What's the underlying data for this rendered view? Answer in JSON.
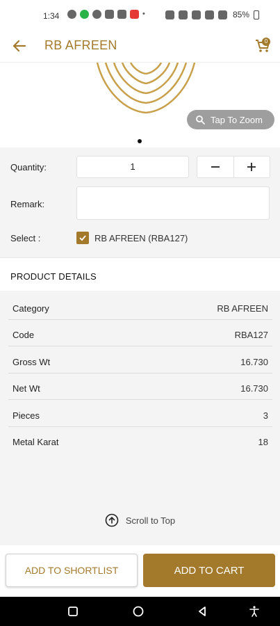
{
  "status_bar": {
    "time": "1:34",
    "battery": "85%"
  },
  "app_bar": {
    "title": "RB AFREEN",
    "cart_count": "0"
  },
  "image": {
    "zoom_label": "Tap To Zoom"
  },
  "form": {
    "quantity_label": "Quantity:",
    "quantity_value": "1",
    "remark_label": "Remark:",
    "remark_value": "",
    "select_label": "Select :",
    "select_option": "RB AFREEN (RBA127)"
  },
  "details": {
    "title": "PRODUCT DETAILS",
    "rows": [
      {
        "label": "Category",
        "value": "RB AFREEN"
      },
      {
        "label": "Code",
        "value": "RBA127"
      },
      {
        "label": "Gross Wt",
        "value": "16.730"
      },
      {
        "label": "Net Wt",
        "value": "16.730"
      },
      {
        "label": "Pieces",
        "value": "3"
      },
      {
        "label": "Metal Karat",
        "value": "18"
      }
    ]
  },
  "scroll_top_label": "Scroll to Top",
  "actions": {
    "shortlist": "ADD TO SHORTLIST",
    "cart": "ADD TO CART"
  },
  "colors": {
    "accent": "#a37a2c"
  }
}
